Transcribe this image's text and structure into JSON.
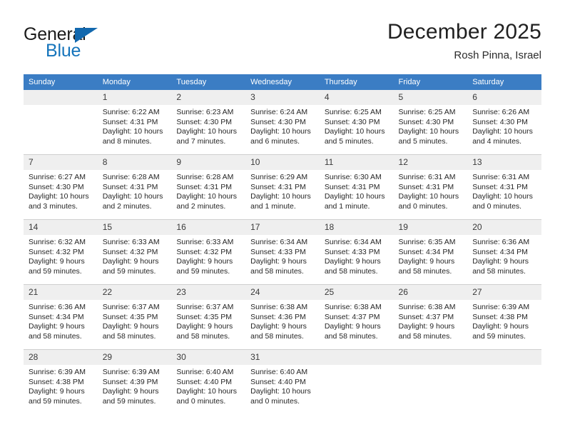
{
  "brand": {
    "name_part1": "General",
    "name_part2": "Blue",
    "triangle_color": "#1268ae",
    "blue_color": "#1574bb"
  },
  "header": {
    "title": "December 2025",
    "subtitle": "Rosh Pinna, Israel"
  },
  "theme": {
    "header_bar_color": "#3b7dc4",
    "daynum_band_color": "#efefef",
    "grid_line_color": "#cfcfcf",
    "text_color": "#262626"
  },
  "weekday_headers": [
    "Sunday",
    "Monday",
    "Tuesday",
    "Wednesday",
    "Thursday",
    "Friday",
    "Saturday"
  ],
  "labels": {
    "sunrise_prefix": "Sunrise:",
    "sunset_prefix": "Sunset:",
    "daylight_prefix": "Daylight:"
  },
  "weeks": [
    [
      {
        "day": "",
        "empty": true,
        "l1": "",
        "l2": "",
        "l3": "",
        "l4": ""
      },
      {
        "day": "1",
        "l1": "Sunrise: 6:22 AM",
        "l2": "Sunset: 4:31 PM",
        "l3": "Daylight: 10 hours",
        "l4": "and 8 minutes."
      },
      {
        "day": "2",
        "l1": "Sunrise: 6:23 AM",
        "l2": "Sunset: 4:30 PM",
        "l3": "Daylight: 10 hours",
        "l4": "and 7 minutes."
      },
      {
        "day": "3",
        "l1": "Sunrise: 6:24 AM",
        "l2": "Sunset: 4:30 PM",
        "l3": "Daylight: 10 hours",
        "l4": "and 6 minutes."
      },
      {
        "day": "4",
        "l1": "Sunrise: 6:25 AM",
        "l2": "Sunset: 4:30 PM",
        "l3": "Daylight: 10 hours",
        "l4": "and 5 minutes."
      },
      {
        "day": "5",
        "l1": "Sunrise: 6:25 AM",
        "l2": "Sunset: 4:30 PM",
        "l3": "Daylight: 10 hours",
        "l4": "and 5 minutes."
      },
      {
        "day": "6",
        "l1": "Sunrise: 6:26 AM",
        "l2": "Sunset: 4:30 PM",
        "l3": "Daylight: 10 hours",
        "l4": "and 4 minutes."
      }
    ],
    [
      {
        "day": "7",
        "l1": "Sunrise: 6:27 AM",
        "l2": "Sunset: 4:30 PM",
        "l3": "Daylight: 10 hours",
        "l4": "and 3 minutes."
      },
      {
        "day": "8",
        "l1": "Sunrise: 6:28 AM",
        "l2": "Sunset: 4:31 PM",
        "l3": "Daylight: 10 hours",
        "l4": "and 2 minutes."
      },
      {
        "day": "9",
        "l1": "Sunrise: 6:28 AM",
        "l2": "Sunset: 4:31 PM",
        "l3": "Daylight: 10 hours",
        "l4": "and 2 minutes."
      },
      {
        "day": "10",
        "l1": "Sunrise: 6:29 AM",
        "l2": "Sunset: 4:31 PM",
        "l3": "Daylight: 10 hours",
        "l4": "and 1 minute."
      },
      {
        "day": "11",
        "l1": "Sunrise: 6:30 AM",
        "l2": "Sunset: 4:31 PM",
        "l3": "Daylight: 10 hours",
        "l4": "and 1 minute."
      },
      {
        "day": "12",
        "l1": "Sunrise: 6:31 AM",
        "l2": "Sunset: 4:31 PM",
        "l3": "Daylight: 10 hours",
        "l4": "and 0 minutes."
      },
      {
        "day": "13",
        "l1": "Sunrise: 6:31 AM",
        "l2": "Sunset: 4:31 PM",
        "l3": "Daylight: 10 hours",
        "l4": "and 0 minutes."
      }
    ],
    [
      {
        "day": "14",
        "l1": "Sunrise: 6:32 AM",
        "l2": "Sunset: 4:32 PM",
        "l3": "Daylight: 9 hours",
        "l4": "and 59 minutes."
      },
      {
        "day": "15",
        "l1": "Sunrise: 6:33 AM",
        "l2": "Sunset: 4:32 PM",
        "l3": "Daylight: 9 hours",
        "l4": "and 59 minutes."
      },
      {
        "day": "16",
        "l1": "Sunrise: 6:33 AM",
        "l2": "Sunset: 4:32 PM",
        "l3": "Daylight: 9 hours",
        "l4": "and 59 minutes."
      },
      {
        "day": "17",
        "l1": "Sunrise: 6:34 AM",
        "l2": "Sunset: 4:33 PM",
        "l3": "Daylight: 9 hours",
        "l4": "and 58 minutes."
      },
      {
        "day": "18",
        "l1": "Sunrise: 6:34 AM",
        "l2": "Sunset: 4:33 PM",
        "l3": "Daylight: 9 hours",
        "l4": "and 58 minutes."
      },
      {
        "day": "19",
        "l1": "Sunrise: 6:35 AM",
        "l2": "Sunset: 4:34 PM",
        "l3": "Daylight: 9 hours",
        "l4": "and 58 minutes."
      },
      {
        "day": "20",
        "l1": "Sunrise: 6:36 AM",
        "l2": "Sunset: 4:34 PM",
        "l3": "Daylight: 9 hours",
        "l4": "and 58 minutes."
      }
    ],
    [
      {
        "day": "21",
        "l1": "Sunrise: 6:36 AM",
        "l2": "Sunset: 4:34 PM",
        "l3": "Daylight: 9 hours",
        "l4": "and 58 minutes."
      },
      {
        "day": "22",
        "l1": "Sunrise: 6:37 AM",
        "l2": "Sunset: 4:35 PM",
        "l3": "Daylight: 9 hours",
        "l4": "and 58 minutes."
      },
      {
        "day": "23",
        "l1": "Sunrise: 6:37 AM",
        "l2": "Sunset: 4:35 PM",
        "l3": "Daylight: 9 hours",
        "l4": "and 58 minutes."
      },
      {
        "day": "24",
        "l1": "Sunrise: 6:38 AM",
        "l2": "Sunset: 4:36 PM",
        "l3": "Daylight: 9 hours",
        "l4": "and 58 minutes."
      },
      {
        "day": "25",
        "l1": "Sunrise: 6:38 AM",
        "l2": "Sunset: 4:37 PM",
        "l3": "Daylight: 9 hours",
        "l4": "and 58 minutes."
      },
      {
        "day": "26",
        "l1": "Sunrise: 6:38 AM",
        "l2": "Sunset: 4:37 PM",
        "l3": "Daylight: 9 hours",
        "l4": "and 58 minutes."
      },
      {
        "day": "27",
        "l1": "Sunrise: 6:39 AM",
        "l2": "Sunset: 4:38 PM",
        "l3": "Daylight: 9 hours",
        "l4": "and 59 minutes."
      }
    ],
    [
      {
        "day": "28",
        "l1": "Sunrise: 6:39 AM",
        "l2": "Sunset: 4:38 PM",
        "l3": "Daylight: 9 hours",
        "l4": "and 59 minutes."
      },
      {
        "day": "29",
        "l1": "Sunrise: 6:39 AM",
        "l2": "Sunset: 4:39 PM",
        "l3": "Daylight: 9 hours",
        "l4": "and 59 minutes."
      },
      {
        "day": "30",
        "l1": "Sunrise: 6:40 AM",
        "l2": "Sunset: 4:40 PM",
        "l3": "Daylight: 10 hours",
        "l4": "and 0 minutes."
      },
      {
        "day": "31",
        "l1": "Sunrise: 6:40 AM",
        "l2": "Sunset: 4:40 PM",
        "l3": "Daylight: 10 hours",
        "l4": "and 0 minutes."
      },
      {
        "day": "",
        "empty": true,
        "l1": "",
        "l2": "",
        "l3": "",
        "l4": ""
      },
      {
        "day": "",
        "empty": true,
        "l1": "",
        "l2": "",
        "l3": "",
        "l4": ""
      },
      {
        "day": "",
        "empty": true,
        "l1": "",
        "l2": "",
        "l3": "",
        "l4": ""
      }
    ]
  ]
}
